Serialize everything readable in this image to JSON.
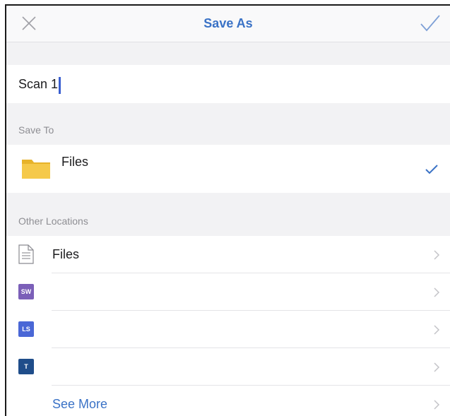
{
  "navbar": {
    "title": "Save As",
    "close_icon": "close-icon",
    "done_icon": "checkmark-icon",
    "accent_color": "#3a72c6"
  },
  "file_name": {
    "value": "Scan 1"
  },
  "save_to": {
    "header": "Save To",
    "selected": {
      "label": "Files",
      "icon": "folder-icon",
      "folder_color": "#f5c518",
      "selected_icon": "checkmark-icon"
    }
  },
  "other_locations": {
    "header": "Other Locations",
    "items": [
      {
        "label": "Files",
        "icon": "document-icon"
      },
      {
        "label": "",
        "badge": "SW",
        "badge_color": "#7b5fb8"
      },
      {
        "label": "",
        "badge": "LS",
        "badge_color": "#4a67d6"
      },
      {
        "label": "",
        "badge": "T",
        "badge_color": "#1f4d8a"
      }
    ],
    "see_more": "See More"
  }
}
